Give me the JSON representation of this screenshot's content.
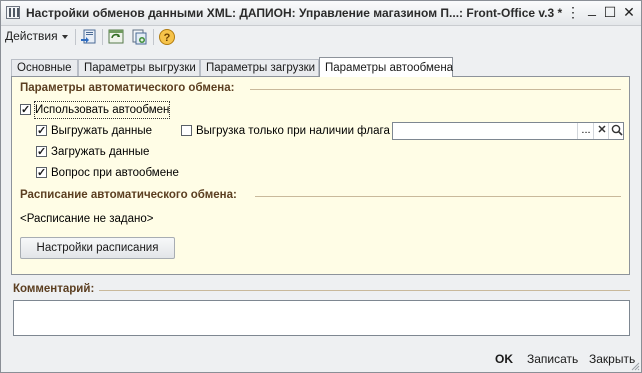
{
  "window": {
    "title": "Настройки обменов данными XML: ДАПИОН: Управление магазином П...: Front-Office v.3 *",
    "buttons": {
      "menu": "⋮",
      "minimize": "_",
      "maximize": "☐",
      "close": "✕"
    }
  },
  "toolbar": {
    "actions_label": "Действия",
    "icons": [
      "save-and-close-icon",
      "refresh-icon",
      "copy-icon",
      "help-icon"
    ]
  },
  "tabs": [
    {
      "label": "Основные",
      "active": false
    },
    {
      "label": "Параметры выгрузки",
      "active": false
    },
    {
      "label": "Параметры загрузки",
      "active": false
    },
    {
      "label": "Параметры автообмена",
      "active": true
    }
  ],
  "auto_exchange": {
    "section_title": "Параметры автоматического обмена:",
    "use_auto": {
      "label": "Использовать автообмен",
      "checked": true
    },
    "upload_data": {
      "label": "Выгружать данные",
      "checked": true
    },
    "upload_flag": {
      "label": "Выгрузка только при наличии флага",
      "checked": false
    },
    "flag_field": {
      "value": "",
      "select_label": "...",
      "clear_label": "✕",
      "open_label": "🔍"
    },
    "download_data": {
      "label": "Загружать данные",
      "checked": true
    },
    "ask_on_auto": {
      "label": "Вопрос при автообмене",
      "checked": true
    }
  },
  "schedule": {
    "section_title": "Расписание автоматического обмена:",
    "status_text": "<Расписание не задано>",
    "settings_button": "Настройки расписания"
  },
  "comment": {
    "label": "Комментарий:",
    "value": ""
  },
  "footer": {
    "ok": "OK",
    "save": "Записать",
    "close": "Закрыть"
  },
  "colors": {
    "panel_background": "#fffde6",
    "section_title": "#5b3e20",
    "window_background": "#eef0f2"
  }
}
